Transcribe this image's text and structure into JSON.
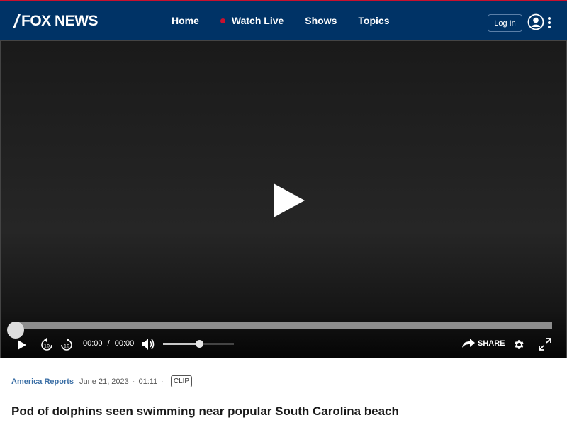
{
  "header": {
    "logo_text": "FOX NEWS",
    "nav": [
      {
        "label": "Home"
      },
      {
        "label": "Watch Live"
      },
      {
        "label": "Shows"
      },
      {
        "label": "Topics"
      }
    ],
    "login_label": "Log In",
    "icons": {
      "account": "account-icon",
      "more": "more-vertical-icon"
    },
    "colors": {
      "bar": "#003366",
      "accent": "#c8102e"
    }
  },
  "player": {
    "current_time": "00:00",
    "time_separator": "/",
    "duration": "00:00",
    "progress": 0,
    "volume": 0.5,
    "share_label": "SHARE",
    "icons": [
      "play-icon",
      "rewind-10-icon",
      "forward-10-icon",
      "volume-icon",
      "share-icon",
      "settings-icon",
      "fullscreen-icon"
    ]
  },
  "article": {
    "show_name": "America Reports",
    "date": "June 21, 2023",
    "length": "01:11",
    "badge": "CLIP",
    "title": "Pod of dolphins seen swimming near popular South Carolina beach"
  }
}
